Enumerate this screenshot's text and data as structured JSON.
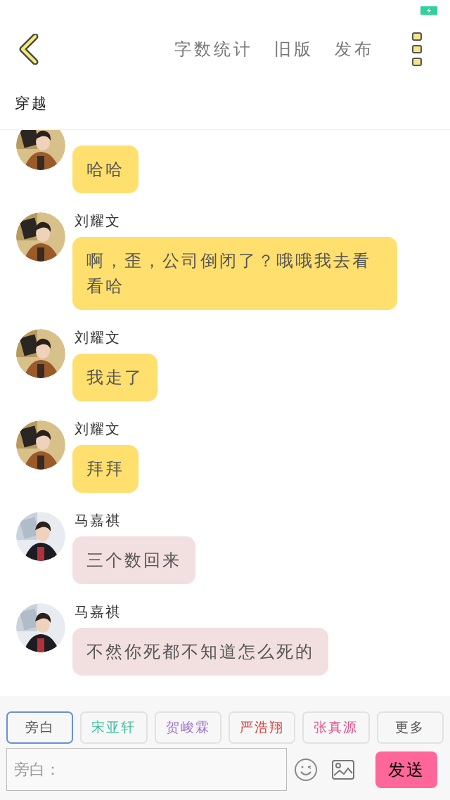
{
  "header": {
    "actions": [
      "字数统计",
      "旧版",
      "发布"
    ]
  },
  "subtitle": "穿越",
  "messages": [
    {
      "text": "哈哈",
      "color": "#ffdf6e"
    },
    {
      "name": "刘耀文",
      "text": "啊，歪，公司倒闭了？哦哦我去看看哈",
      "color": "#ffdf6e"
    },
    {
      "name": "刘耀文",
      "text": "我走了",
      "color": "#ffdf6e"
    },
    {
      "name": "刘耀文",
      "text": "拜拜",
      "color": "#ffdf6e"
    },
    {
      "name": "马嘉祺",
      "text": "三个数回来",
      "color": "#f2dfdf"
    },
    {
      "name": "马嘉祺",
      "text": "不然你死都不知道怎么死的",
      "color": "#f2dfdf"
    }
  ],
  "speakers": [
    {
      "label": "旁白",
      "selected": true,
      "color": "#555555"
    },
    {
      "label": "宋亚轩",
      "selected": false,
      "color": "#3cbf9f"
    },
    {
      "label": "贺峻霖",
      "selected": false,
      "color": "#a070d0"
    },
    {
      "label": "严浩翔",
      "selected": false,
      "color": "#d04040"
    },
    {
      "label": "张真源",
      "selected": false,
      "color": "#e0508a"
    },
    {
      "label": "更多",
      "selected": false,
      "color": "#555555"
    }
  ],
  "input": {
    "placeholder": "旁白："
  },
  "send_button": "发送"
}
